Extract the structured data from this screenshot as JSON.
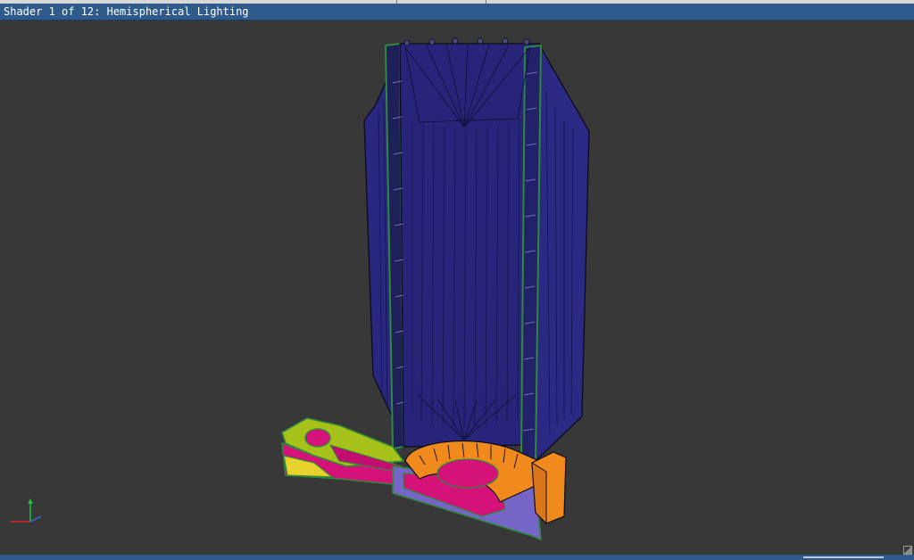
{
  "window": {
    "title": "Shader 1 of 12: Hemispherical Lighting"
  },
  "viewport": {
    "background": "#383838",
    "model": "extruder-assembly-3d",
    "colors": {
      "body": "#262475",
      "body_light": "#3a37a0",
      "edge": "#0b0b1a",
      "trim": "#2d8a3a",
      "chute": "#a6c11a",
      "chute_dark": "#7d9616",
      "magenta": "#d4127a",
      "orange": "#f08a1c",
      "purple": "#7565c6",
      "yellow": "#e8d22c"
    },
    "axes_gizmo": {
      "x_color": "#d62828",
      "y_color": "#1fbf3a",
      "z_color": "#3a6ad8"
    }
  }
}
